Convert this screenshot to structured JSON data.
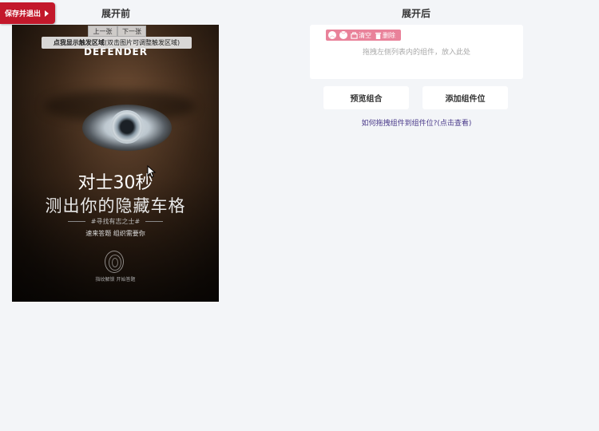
{
  "header": {
    "save_exit_label": "保存并退出",
    "before_title": "展开前",
    "after_title": "展开后"
  },
  "poster": {
    "brand": "DEFENDER",
    "headline": "对士30秒",
    "subheadline": "测出你的隐藏车格",
    "tagline": "#寻找有志之士#",
    "small_text": "速来答题 组织需要你",
    "fingerprint_text": "指纹解锁 开始答题"
  },
  "overlay": {
    "prev_label": "上一张",
    "next_label": "下一张",
    "touch_hint_bold": "点我显示触发区域",
    "touch_hint_rest": "(双击图片可调整触发区域)"
  },
  "component": {
    "clear_label": "清空",
    "delete_label": "删除",
    "drop_hint": "拖拽左侧列表内的组件，放入此处"
  },
  "actions": {
    "preview_label": "预览组合",
    "add_slot_label": "添加组件位"
  },
  "help": {
    "link_text": "如何拖拽组件到组件位?(点击查看)"
  },
  "colors": {
    "save_exit_bg": "#c3182b",
    "toolbar_bg": "#e9829a",
    "link": "#4a3a8a",
    "page_bg": "#f3f5f8"
  }
}
